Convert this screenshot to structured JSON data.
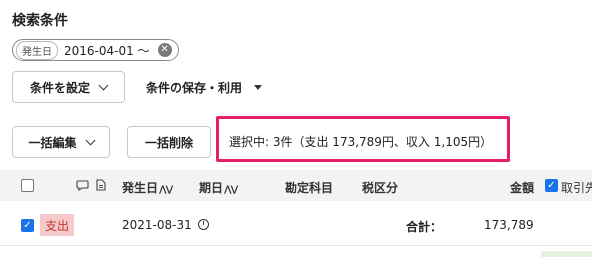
{
  "search": {
    "title": "検索条件",
    "filter_chip": {
      "key": "発生日",
      "value": "2016-04-01 〜"
    }
  },
  "toolbar": {
    "set_conditions_label": "条件を設定",
    "save_use_label": "条件の保存・利用",
    "bulk_edit_label": "一括編集",
    "bulk_delete_label": "一括削除"
  },
  "selection": {
    "text": "選択中: 3件（支出 173,789円、収入 1,105円）"
  },
  "table": {
    "headers": {
      "date": "発生日",
      "due": "期日",
      "account": "勘定科目",
      "tax": "税区分",
      "amount": "金額",
      "partner": "取引先"
    },
    "sort_glyph": "⋀⋁",
    "row": {
      "type": "支出",
      "date": "2021-08-31",
      "total_label": "合計：",
      "total_value": "173,789"
    }
  },
  "colors": {
    "accent": "#e51f6c",
    "checkbox": "#1a73e8",
    "expense_badge_bg": "#f6c9cc",
    "expense_badge_text": "#c0392b"
  }
}
